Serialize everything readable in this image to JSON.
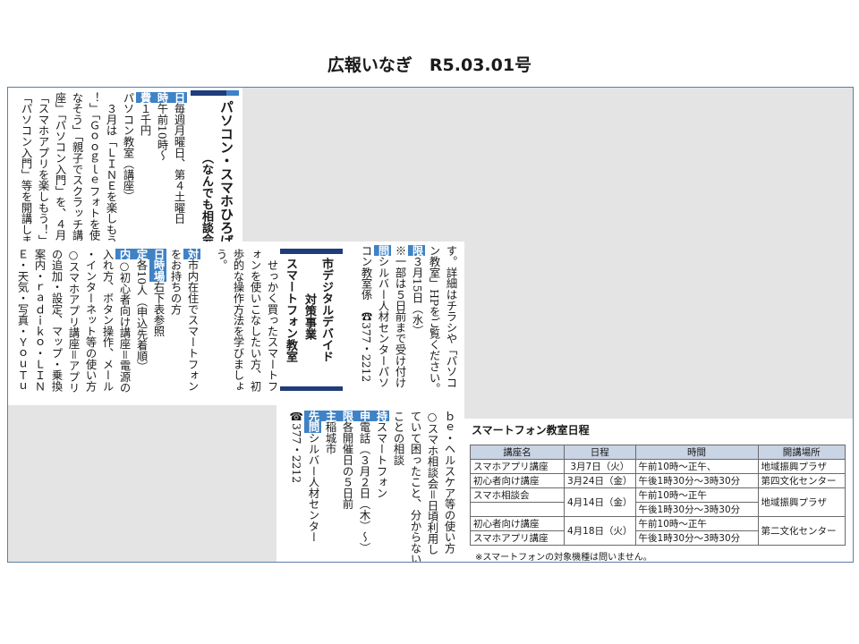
{
  "page_title": "広報いなぎ　R5.03.01号",
  "col_a": {
    "heading": "パソコン・スマホひろば",
    "subheading": "（なんでも相談会）",
    "lines": [
      {
        "badge": "日",
        "text": "毎週月曜日、第４土曜日"
      },
      {
        "badge": "時",
        "text": "午前10時～"
      },
      {
        "badge": "費",
        "text": "１千円"
      },
      {
        "badge": "",
        "text": "パソコン教室（講座）"
      },
      {
        "badge": "",
        "text": "　３月は「ＬＩＮＥを楽しもう"
      },
      {
        "badge": "",
        "text": "！」「Ｇｏｏｇｌｅフォトを使いこ"
      },
      {
        "badge": "",
        "text": "なそう」「親子でスクラッチ講"
      },
      {
        "badge": "",
        "text": "座」「パソコン入門」を、４月は"
      },
      {
        "badge": "",
        "text": "「スマホアプリを楽しもう！」"
      },
      {
        "badge": "",
        "text": "「パソコン入門」等を開講しま"
      }
    ]
  },
  "col_b": {
    "lines": [
      {
        "badge": "",
        "text": "す。詳細はチラシや「パソコ"
      },
      {
        "badge": "",
        "text": "ン教室」HPをご覧ください。"
      },
      {
        "badge": "限",
        "text": "３月15日（水）"
      },
      {
        "badge": "",
        "text": "※一部は５日前まで受け付け"
      },
      {
        "badge": "問",
        "text": "シルバー人材センターパソ"
      },
      {
        "badge": "",
        "text": "コン教室係　☎377・2212"
      }
    ]
  },
  "col_c": {
    "heading1": "市デジタルデバイド",
    "heading2": "対策事業",
    "heading3": "スマートフォン教室",
    "lines": [
      {
        "badge": "",
        "text": "　せっかく買ったスマートフ"
      },
      {
        "badge": "",
        "text": "ォンを使いこなしたい方、初"
      },
      {
        "badge": "",
        "text": "歩的な操作方法を学びましょ"
      },
      {
        "badge": "",
        "text": "う。"
      },
      {
        "badge": "対",
        "text": "市内在住でスマートフォン"
      },
      {
        "badge": "",
        "text": "をお持ちの方"
      },
      {
        "badge": "日時場",
        "text": "右下表参照"
      },
      {
        "badge": "定",
        "text": "各10人（申込先着順）"
      },
      {
        "badge": "内",
        "text": "○初心者向け講座＝電源の"
      },
      {
        "badge": "",
        "text": "入れ方、ボタン操作、メール"
      },
      {
        "badge": "",
        "text": "・インターネット等の使い方"
      },
      {
        "badge": "",
        "text": "○スマホアプリ講座＝アプリ"
      },
      {
        "badge": "",
        "text": "の追加・設定、マップ・乗換"
      },
      {
        "badge": "",
        "text": "案内・ｒａｄｉｋｏ・ＬＩＮ"
      },
      {
        "badge": "",
        "text": "Ｅ・天気・写真・ＹｏｕＴｕ"
      }
    ]
  },
  "col_d": {
    "lines": [
      {
        "badge": "",
        "text": "ｂｅ・ヘルスケア等の使い方"
      },
      {
        "badge": "",
        "text": "○スマホ相談会＝日頃利用し"
      },
      {
        "badge": "",
        "text": "ていて困ったこと、分からない"
      },
      {
        "badge": "",
        "text": "ことの相談"
      },
      {
        "badge": "持",
        "text": "スマートフォン"
      },
      {
        "badge": "申",
        "text": "電話（３月２日（木）～）"
      },
      {
        "badge": "限",
        "text": "各開催日の５日前"
      },
      {
        "badge": "主",
        "text": "稲城市"
      },
      {
        "badge": "先問",
        "text": "シルバー人材センター"
      },
      {
        "badge": "",
        "text": "☎377・2212"
      }
    ]
  },
  "schedule": {
    "caption": "スマートフォン教室日程",
    "headers": [
      "講座名",
      "日程",
      "時間",
      "開講場所"
    ],
    "rows": [
      {
        "course": "スマホアプリ講座",
        "date": "3月7日（火）",
        "time": "午前10時～正午、",
        "place": "地域振興プラザ"
      },
      {
        "course": "初心者向け講座",
        "date": "3月24日（金）",
        "time": "午後1時30分～3時30分",
        "place": "第四文化センター"
      },
      {
        "course": "スマホ相談会",
        "date": "4月14日（金）",
        "time": "午前10時～正午",
        "place": "地域振興プラザ"
      },
      {
        "course": "",
        "date": "",
        "time": "午後1時30分～3時30分",
        "place": ""
      },
      {
        "course": "初心者向け講座",
        "date": "4月18日（火）",
        "time": "午前10時～正午",
        "place": "第二文化センター"
      },
      {
        "course": "スマホアプリ講座",
        "date": "",
        "time": "午後1時30分～3時30分",
        "place": ""
      }
    ],
    "note": "※スマートフォンの対象機種は問いません。"
  },
  "colors": {
    "accent": "#3f82c5",
    "bar_dark": "#1f3d7a",
    "panel_grey": "#e4e4e4",
    "border": "#5b7fa8"
  }
}
